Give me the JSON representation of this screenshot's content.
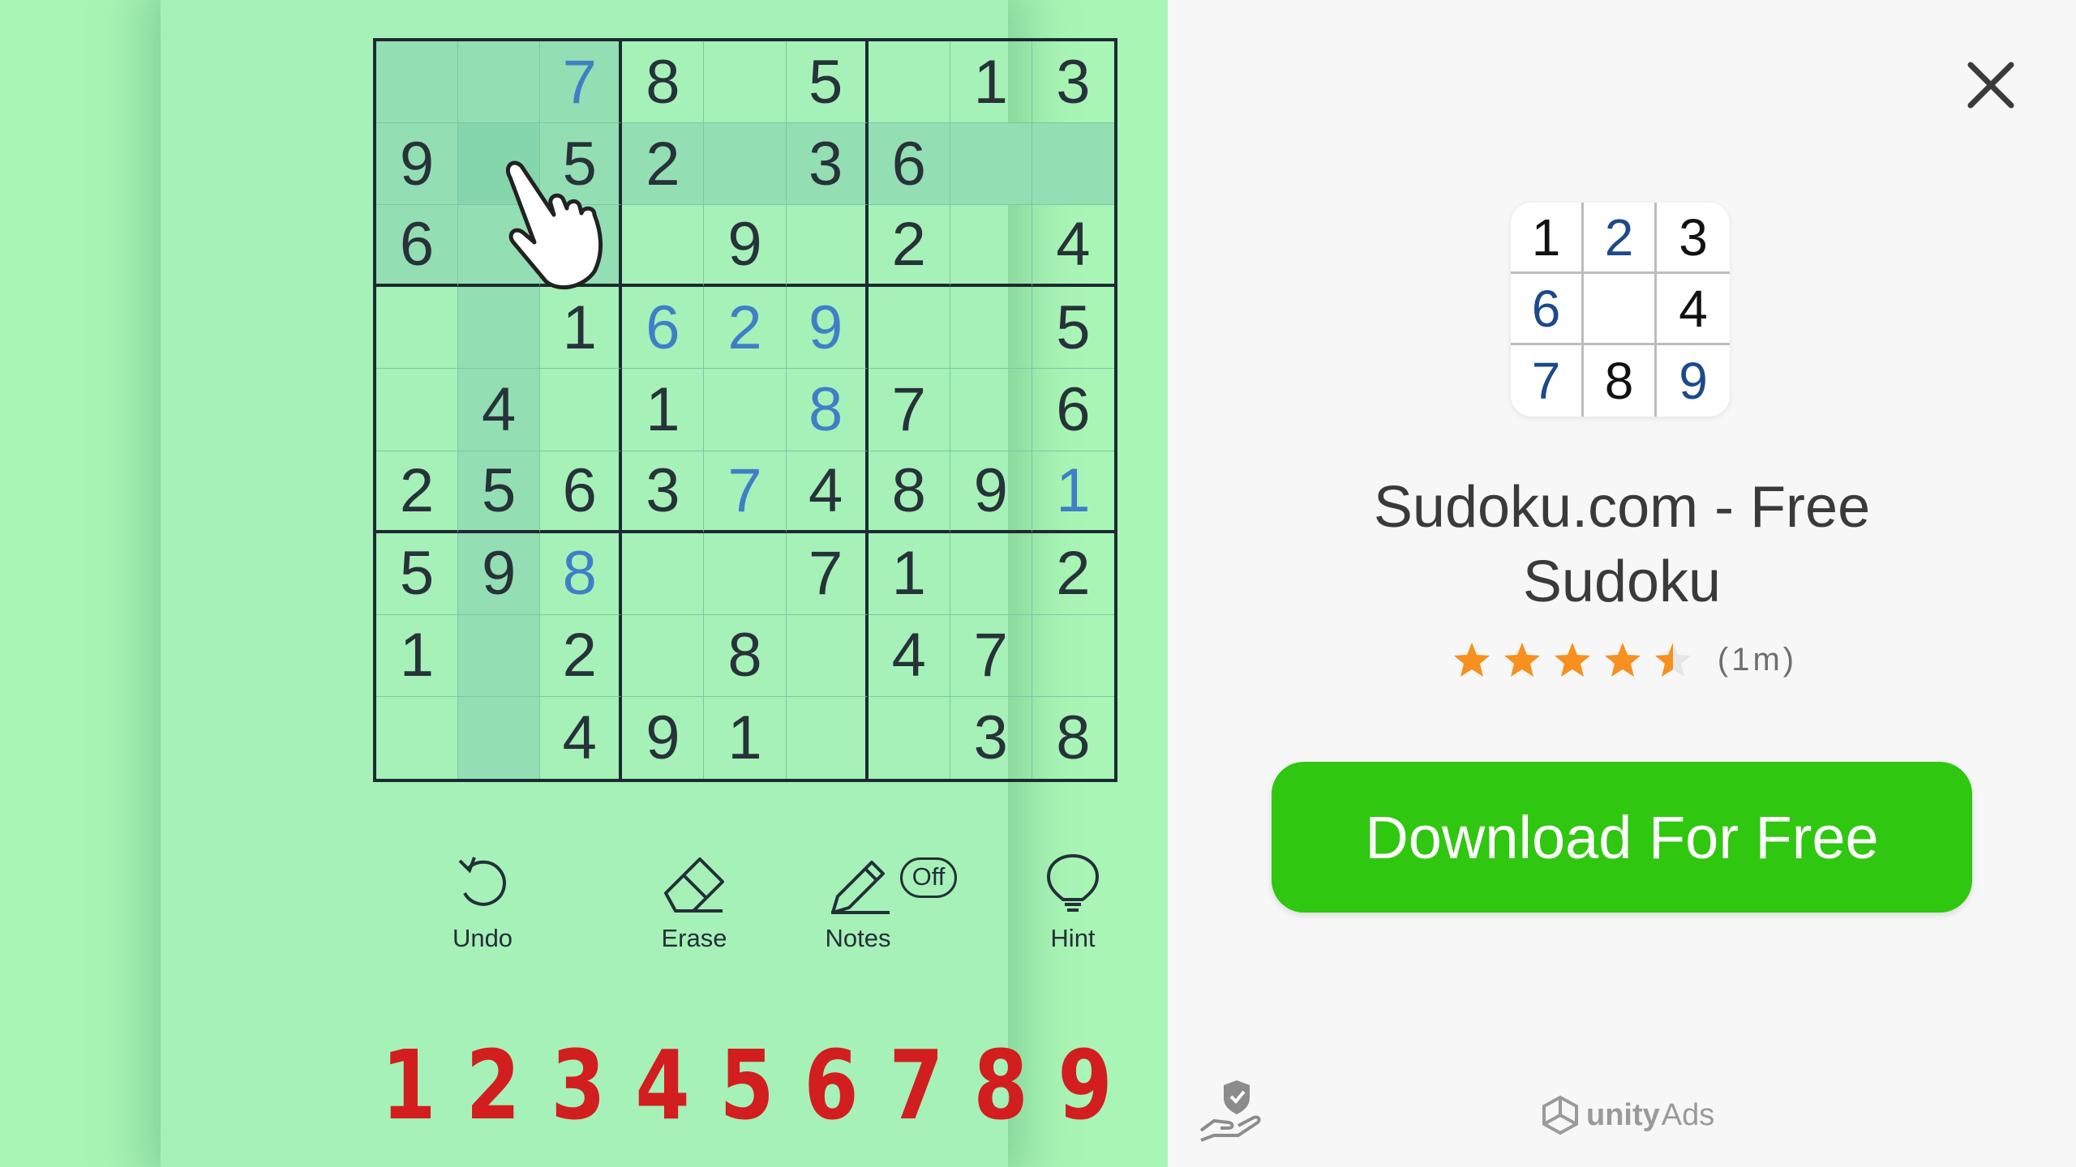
{
  "game_preview": {
    "board": [
      [
        "",
        "",
        "7",
        "8",
        "",
        "5",
        "",
        "1",
        "3"
      ],
      [
        "9",
        "",
        "5",
        "2",
        "",
        "3",
        "6",
        "",
        ""
      ],
      [
        "6",
        "",
        "",
        "",
        "9",
        "",
        "2",
        "",
        "4"
      ],
      [
        "",
        "",
        "1",
        "6",
        "2",
        "9",
        "",
        "",
        "5"
      ],
      [
        "",
        "4",
        "",
        "1",
        "",
        "8",
        "7",
        "",
        "6"
      ],
      [
        "2",
        "5",
        "6",
        "3",
        "7",
        "4",
        "8",
        "9",
        "1"
      ],
      [
        "5",
        "9",
        "8",
        "",
        "",
        "7",
        "1",
        "",
        "2"
      ],
      [
        "1",
        "",
        "2",
        "",
        "8",
        "",
        "4",
        "7",
        ""
      ],
      [
        "",
        "",
        "4",
        "9",
        "1",
        "",
        "",
        "3",
        "8"
      ]
    ],
    "user_entered": [
      [
        0,
        2
      ],
      [
        3,
        3
      ],
      [
        3,
        4
      ],
      [
        3,
        5
      ],
      [
        4,
        5
      ],
      [
        5,
        4
      ],
      [
        5,
        8
      ],
      [
        6,
        2
      ]
    ],
    "selected_cell": [
      1,
      1
    ],
    "tools": [
      {
        "label": "Undo",
        "icon": "undo-icon"
      },
      {
        "label": "Erase",
        "icon": "eraser-icon"
      },
      {
        "label": "Notes",
        "icon": "pencil-icon",
        "badge": "Off"
      },
      {
        "label": "Hint",
        "icon": "lightbulb-icon"
      }
    ],
    "number_pad": [
      "1",
      "2",
      "3",
      "4",
      "5",
      "6",
      "7",
      "8",
      "9"
    ],
    "pointer_icon": "hand-pointer-icon",
    "colors": {
      "background": "#a9f5b6",
      "given_digit": "#27323a",
      "user_digit": "#3f7fc7",
      "number_pad": "#d21e1e"
    }
  },
  "ad": {
    "app_icon": {
      "grid": [
        [
          "1",
          "2",
          "3"
        ],
        [
          "6",
          "",
          "4"
        ],
        [
          "7",
          "8",
          "9"
        ]
      ],
      "blue_cells": [
        [
          0,
          1
        ],
        [
          1,
          0
        ],
        [
          2,
          0
        ],
        [
          2,
          2
        ]
      ]
    },
    "app_title": "Sudoku.com - Free Sudoku",
    "rating_stars": 4.5,
    "rating_count": "(1m)",
    "download_label": "Download For Free",
    "close_icon": "close-icon",
    "privacy_icon": "privacy-hand-shield-icon",
    "brand_logo": {
      "icon": "unity-logo-icon",
      "name": "unity",
      "suffix": "Ads"
    },
    "colors": {
      "download_button": "#2fc70f",
      "star": "#f7901e",
      "background": "#f7f7f7"
    }
  }
}
